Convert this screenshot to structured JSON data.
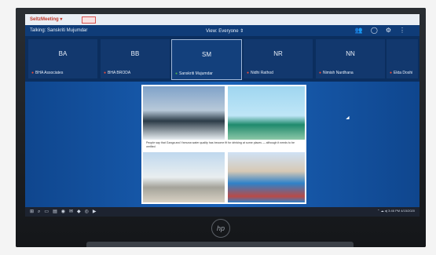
{
  "app": {
    "name": "SeltzMeeting ▾"
  },
  "meeting": {
    "talking": "Talking: Sanskriti Mujumdar",
    "view": "View: Everyone ⇕"
  },
  "participants": [
    {
      "initials": "BA",
      "name": "BHA Associates"
    },
    {
      "initials": "BB",
      "name": "BHA BRODA"
    },
    {
      "initials": "SM",
      "name": "Sanskriti Mujumdar"
    },
    {
      "initials": "NR",
      "name": "Nidhi Rathod"
    },
    {
      "initials": "NN",
      "name": "Nimish Nardhana"
    },
    {
      "initials": "",
      "name": "Ekta Doshi"
    }
  ],
  "slide": {
    "caption": "People say that Ganga and Yamuna water quality has become fit for drinking at some places — although it needs to be verified"
  },
  "taskbar": {
    "time": "3:46 PM",
    "date": "4/15/2020"
  },
  "laptop": {
    "logo": "hp"
  }
}
